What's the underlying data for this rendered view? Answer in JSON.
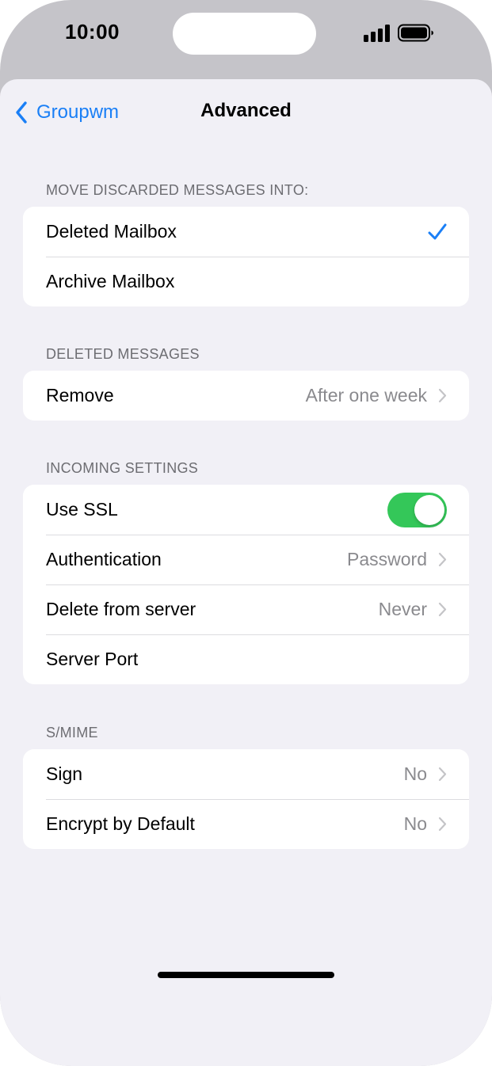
{
  "status_bar": {
    "time": "10:00"
  },
  "nav": {
    "back_label": "Groupwm",
    "title": "Advanced"
  },
  "sections": {
    "discarded": {
      "header": "MOVE DISCARDED MESSAGES INTO:",
      "rows": [
        {
          "label": "Deleted Mailbox",
          "selected": true
        },
        {
          "label": "Archive Mailbox",
          "selected": false
        }
      ]
    },
    "deleted": {
      "header": "DELETED MESSAGES",
      "rows": [
        {
          "label": "Remove",
          "value": "After one week"
        }
      ]
    },
    "incoming": {
      "header": "INCOMING SETTINGS",
      "rows": [
        {
          "label": "Use SSL",
          "toggle_on": true
        },
        {
          "label": "Authentication",
          "value": "Password"
        },
        {
          "label": "Delete from server",
          "value": "Never"
        },
        {
          "label": "Server Port",
          "value": ""
        }
      ]
    },
    "smime": {
      "header": "S/MIME",
      "rows": [
        {
          "label": "Sign",
          "value": "No"
        },
        {
          "label": "Encrypt by Default",
          "value": "No"
        }
      ]
    }
  },
  "colors": {
    "accent": "#1a7ff6",
    "toggle_on": "#34c759",
    "background": "#f1f0f6",
    "secondary_text": "#8a8a8e"
  }
}
